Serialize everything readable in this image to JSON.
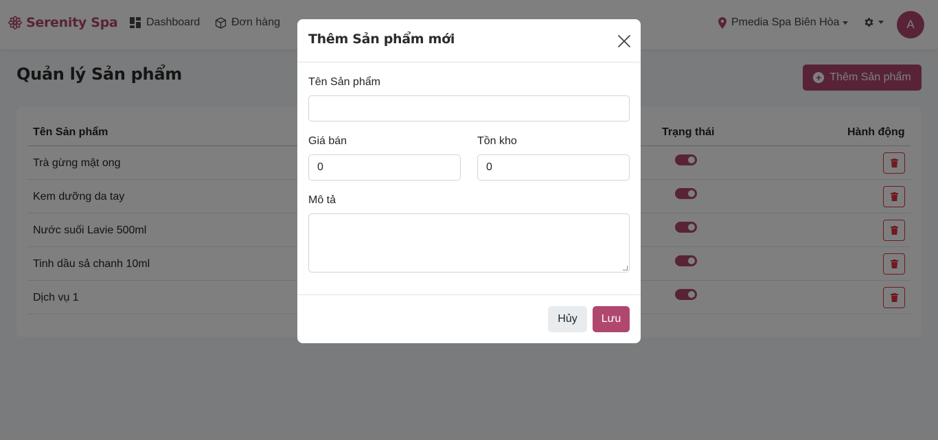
{
  "brand": {
    "name": "Serenity Spa",
    "icon": "lotus-icon",
    "color": "#b0476f"
  },
  "nav": {
    "items": [
      {
        "label": "Dashboard",
        "icon": "dashboard-icon"
      },
      {
        "label": "Đơn hàng",
        "icon": "box-icon"
      }
    ],
    "location": "Pmedia Spa Biên Hòa",
    "avatar_initial": "A"
  },
  "page": {
    "title": "Quản lý Sản phẩm",
    "add_button": "Thêm Sản phẩm"
  },
  "table": {
    "columns": {
      "name": "Tên Sản phẩm",
      "status": "Trạng thái",
      "actions": "Hành động"
    },
    "rows": [
      {
        "name": "Trà gừng mật ong",
        "active": true
      },
      {
        "name": "Kem dưỡng da tay",
        "active": true
      },
      {
        "name": "Nước suối Lavie 500ml",
        "active": true
      },
      {
        "name": "Tinh dầu sả chanh 10ml",
        "active": true
      },
      {
        "name": "Dịch vụ 1",
        "active": true
      }
    ]
  },
  "modal": {
    "title": "Thêm Sản phẩm mới",
    "fields": {
      "name_label": "Tên Sản phẩm",
      "name_value": "",
      "price_label": "Giá bán",
      "price_value": "0",
      "stock_label": "Tồn kho",
      "stock_value": "0",
      "description_label": "Mô tả",
      "description_value": ""
    },
    "cancel_label": "Hủy",
    "save_label": "Lưu"
  },
  "colors": {
    "accent": "#b0476f",
    "danger": "#dc3545"
  }
}
